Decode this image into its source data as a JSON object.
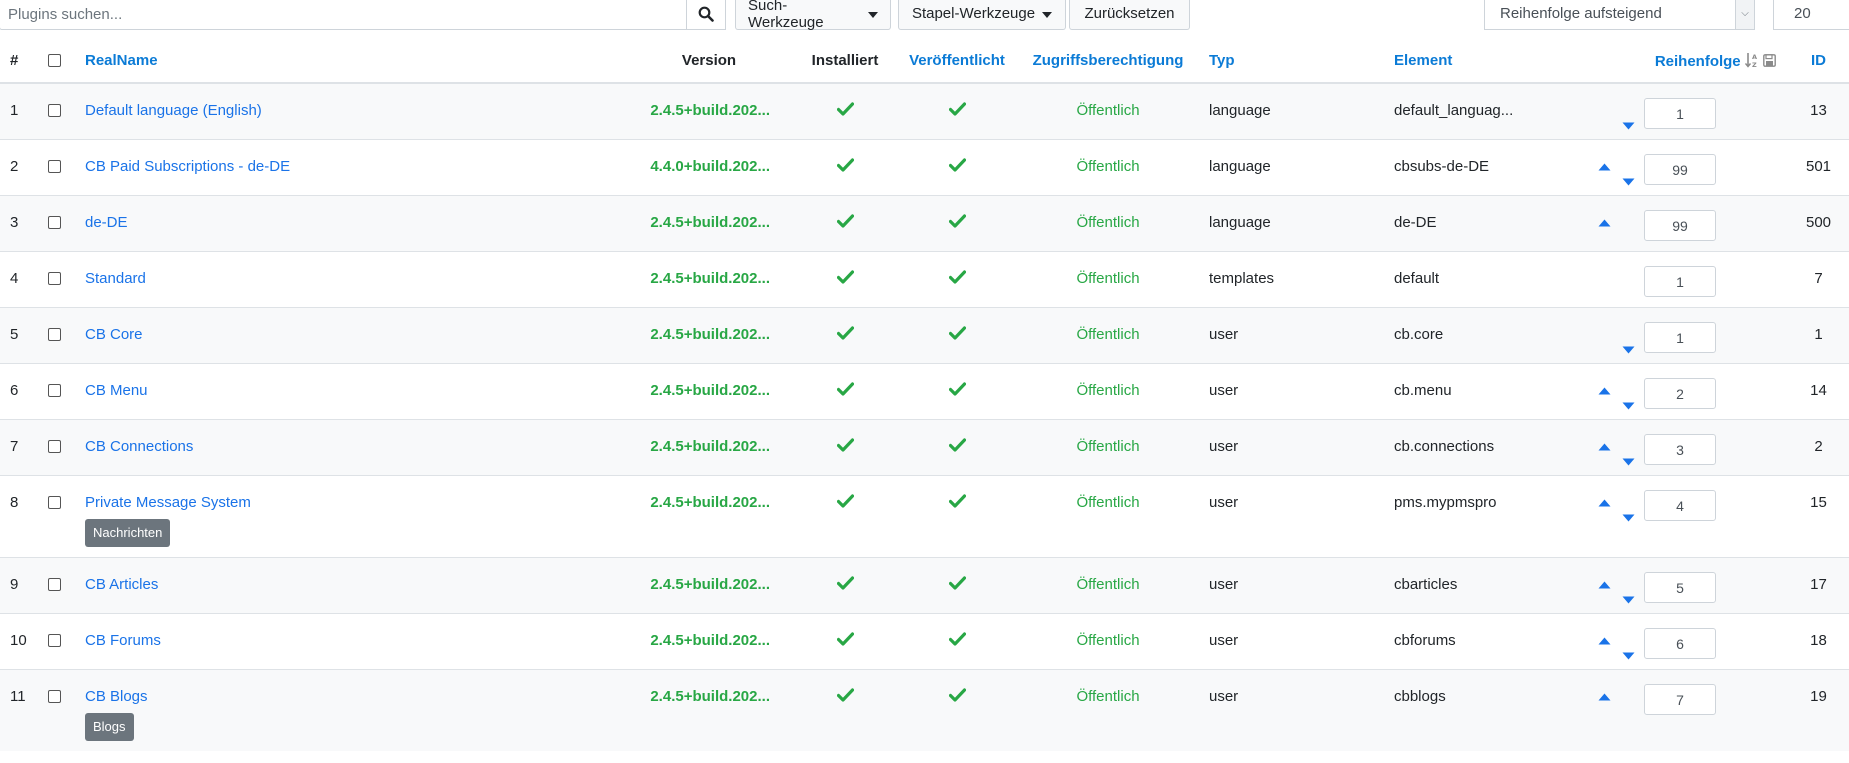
{
  "toolbar": {
    "search_placeholder": "Plugins suchen...",
    "search_tools_label": "Such-Werkzeuge",
    "batch_tools_label": "Stapel-Werkzeuge",
    "reset_label": "Zurücksetzen",
    "ordering_value": "Reihenfolge aufsteigend",
    "limit_value": "20"
  },
  "table": {
    "headers": {
      "num": "#",
      "realname": "RealName",
      "version": "Version",
      "installed": "Installiert",
      "published": "Veröffentlicht",
      "access": "Zugriffsberechtigung",
      "type": "Typ",
      "element": "Element",
      "ordering": "Reihenfolge",
      "id": "ID"
    },
    "rows": [
      {
        "num": "1",
        "name": "Default language (English)",
        "version": "2.4.5+build.202...",
        "access": "Öffentlich",
        "type": "language",
        "element": "default_languag...",
        "order": "1",
        "id": "13",
        "up": false,
        "down": true,
        "badge": ""
      },
      {
        "num": "2",
        "name": "CB Paid Subscriptions - de-DE",
        "version": "4.4.0+build.202...",
        "access": "Öffentlich",
        "type": "language",
        "element": "cbsubs-de-DE",
        "order": "99",
        "id": "501",
        "up": true,
        "down": true,
        "badge": ""
      },
      {
        "num": "3",
        "name": "de-DE",
        "version": "2.4.5+build.202...",
        "access": "Öffentlich",
        "type": "language",
        "element": "de-DE",
        "order": "99",
        "id": "500",
        "up": true,
        "down": false,
        "badge": ""
      },
      {
        "num": "4",
        "name": "Standard",
        "version": "2.4.5+build.202...",
        "access": "Öffentlich",
        "type": "templates",
        "element": "default",
        "order": "1",
        "id": "7",
        "up": false,
        "down": false,
        "badge": ""
      },
      {
        "num": "5",
        "name": "CB Core",
        "version": "2.4.5+build.202...",
        "access": "Öffentlich",
        "type": "user",
        "element": "cb.core",
        "order": "1",
        "id": "1",
        "up": false,
        "down": true,
        "badge": ""
      },
      {
        "num": "6",
        "name": "CB Menu",
        "version": "2.4.5+build.202...",
        "access": "Öffentlich",
        "type": "user",
        "element": "cb.menu",
        "order": "2",
        "id": "14",
        "up": true,
        "down": true,
        "badge": ""
      },
      {
        "num": "7",
        "name": "CB Connections",
        "version": "2.4.5+build.202...",
        "access": "Öffentlich",
        "type": "user",
        "element": "cb.connections",
        "order": "3",
        "id": "2",
        "up": true,
        "down": true,
        "badge": ""
      },
      {
        "num": "8",
        "name": "Private Message System",
        "version": "2.4.5+build.202...",
        "access": "Öffentlich",
        "type": "user",
        "element": "pms.mypmspro",
        "order": "4",
        "id": "15",
        "up": true,
        "down": true,
        "badge": "Nachrichten"
      },
      {
        "num": "9",
        "name": "CB Articles",
        "version": "2.4.5+build.202...",
        "access": "Öffentlich",
        "type": "user",
        "element": "cbarticles",
        "order": "5",
        "id": "17",
        "up": true,
        "down": true,
        "badge": ""
      },
      {
        "num": "10",
        "name": "CB Forums",
        "version": "2.4.5+build.202...",
        "access": "Öffentlich",
        "type": "user",
        "element": "cbforums",
        "order": "6",
        "id": "18",
        "up": true,
        "down": true,
        "badge": ""
      },
      {
        "num": "11",
        "name": "CB Blogs",
        "version": "2.4.5+build.202...",
        "access": "Öffentlich",
        "type": "user",
        "element": "cbblogs",
        "order": "7",
        "id": "19",
        "up": true,
        "down": false,
        "badge": "Blogs"
      }
    ]
  },
  "colors": {
    "link": "#1a73e8",
    "success": "#28a745",
    "badge_bg": "#6c757d"
  }
}
